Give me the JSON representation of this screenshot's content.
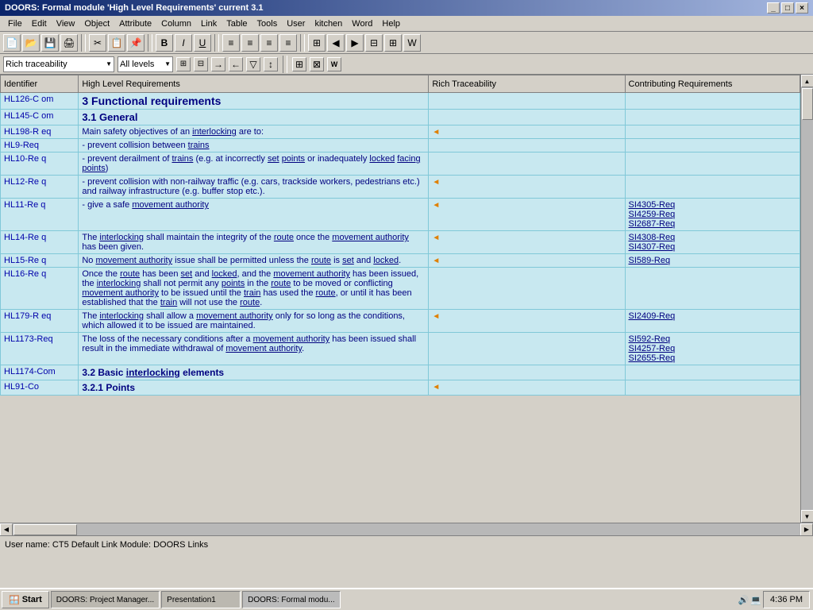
{
  "titlebar": {
    "title": "DOORS: Formal module 'High Level Requirements' current 3.1",
    "controls": [
      "_",
      "□",
      "×"
    ]
  },
  "menubar": {
    "items": [
      "File",
      "Edit",
      "View",
      "Object",
      "Attribute",
      "Column",
      "Link",
      "Table",
      "Tools",
      "User",
      "kitchen",
      "Word",
      "Help"
    ]
  },
  "toolbar2": {
    "style_value": "Rich traceability",
    "level_value": "All levels"
  },
  "columns": {
    "identifier": "Identifier",
    "hlreq": "High Level Requirements",
    "rich": "Rich Traceability",
    "contrib": "Contributing Requirements"
  },
  "rows": [
    {
      "id": "HL126-C om",
      "content_type": "heading1",
      "content": "3 Functional requirements",
      "rich": "",
      "contrib": ""
    },
    {
      "id": "HL145-C om",
      "content_type": "heading2",
      "content": "3.1 General",
      "rich": "",
      "contrib": ""
    },
    {
      "id": "HL198-R eq",
      "content_type": "text",
      "content": "Main safety objectives of an interlocking are to:",
      "rich": "arrow",
      "contrib": "",
      "underline_words": [
        "interlocking"
      ]
    },
    {
      "id": "HL9-Req",
      "content_type": "text",
      "content": "- prevent collision between trains",
      "rich": "",
      "contrib": "",
      "underline_words": [
        "trains"
      ]
    },
    {
      "id": "HL10-Re q",
      "content_type": "text",
      "content": "- prevent derailment of trains (e.g. at incorrectly set points or inadequately locked facing points)",
      "rich": "",
      "contrib": "",
      "underline_words": [
        "trains",
        "points",
        "locked",
        "facing",
        "points"
      ]
    },
    {
      "id": "HL12-Re q",
      "content_type": "text",
      "content": "- prevent collision with non-railway traffic (e.g. cars, trackside workers, pedestrians etc.) and railway infrastructure (e.g. buffer stop etc.).",
      "rich": "arrow",
      "contrib": ""
    },
    {
      "id": "HL11-Re q",
      "content_type": "text",
      "content": "- give a safe movement authority",
      "rich": "arrow",
      "contrib": "SI4305-Req\nSI4259-Req\nSI2687-Req",
      "underline_words": [
        "movement",
        "authority"
      ]
    },
    {
      "id": "HL14-Re q",
      "content_type": "text",
      "content": "The interlocking shall maintain the integrity of the route once the movement authority has been given.",
      "rich": "arrow",
      "contrib": "SI4308-Req\nSI4307-Req",
      "underline_words": [
        "interlocking",
        "route",
        "movement",
        "authority"
      ]
    },
    {
      "id": "HL15-Re q",
      "content_type": "text",
      "content": "No movement authority issue shall be permitted unless the route is set and locked.",
      "rich": "arrow",
      "contrib": "SI589-Req",
      "underline_words": [
        "movement",
        "authority",
        "route",
        "set",
        "locked"
      ]
    },
    {
      "id": "HL16-Re q",
      "content_type": "text",
      "content": "Once the route has been set and locked, and the movement authority has been issued, the interlocking shall not permit any points in the route to be moved or conflicting movement authority to be issued until the train has used the route, or until it has been established that the train will not use the route.",
      "rich": "",
      "contrib": "",
      "underline_words": [
        "route",
        "set",
        "locked",
        "movement",
        "authority",
        "interlocking",
        "points",
        "route",
        "movement",
        "authority",
        "train",
        "route",
        "train",
        "route"
      ]
    },
    {
      "id": "HL179-R eq",
      "content_type": "text",
      "content": "The interlocking shall allow a movement authority only for so long as the conditions, which allowed it to be issued are maintained.",
      "rich": "arrow",
      "contrib": "SI2409-Req",
      "underline_words": [
        "interlocking",
        "movement",
        "authority"
      ]
    },
    {
      "id": "HL1173-Req",
      "content_type": "text",
      "content": "The loss of the necessary conditions after a movement authority has been issued shall result in the immediate withdrawal of movement authority.",
      "rich": "",
      "contrib": "SI592-Req\nSI4257-Req\nSI2655-Req",
      "underline_words": [
        "movement",
        "authority",
        "movement",
        "authority"
      ]
    },
    {
      "id": "HL1174-Com",
      "content_type": "heading3",
      "content": "3.2 Basic interlocking elements",
      "rich": "",
      "contrib": "",
      "underline_words": [
        "interlocking"
      ]
    },
    {
      "id": "HL91-Co",
      "content_type": "heading3",
      "content": "3.2.1 Points",
      "rich": "arrow",
      "contrib": ""
    }
  ],
  "statusbar": {
    "text": "User name: CT5  Default Link Module: DOORS Links"
  },
  "taskbar": {
    "start": "Start",
    "items": [
      "DOORS: Project Manager...",
      "Presentation1",
      "DOORS: Formal modu..."
    ],
    "clock": "4:36 PM"
  }
}
